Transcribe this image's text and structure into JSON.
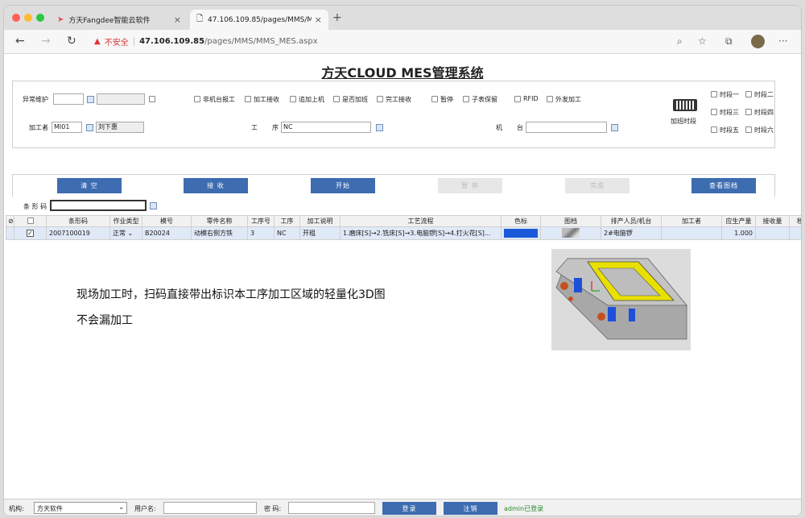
{
  "browser": {
    "tabs": [
      {
        "title": "方天Fangdee智能云软件",
        "close": "×"
      },
      {
        "title": "47.106.109.85/pages/MMS/M",
        "close": "×"
      }
    ],
    "new_tab": "+",
    "security_warning": "不安全",
    "url_host": "47.106.109.85",
    "url_path": "/pages/MMS/MMS_MES.aspx",
    "more": "···"
  },
  "page": {
    "title": "方天CLOUD MES管理系统"
  },
  "form": {
    "exception_label": "异常维护",
    "worker_label": "加工者",
    "worker_code": "MI01",
    "worker_name": "刘下惠",
    "process_label_1": "工",
    "process_label_2": "序",
    "process_value": "NC",
    "machine_label_1": "机",
    "machine_label_2": "台",
    "machine_value": "",
    "options": [
      "非机台报工",
      "加工接收",
      "追加上机",
      "是否加班",
      "完工接收",
      "暂停",
      "子表保留",
      "RFID",
      "外发加工"
    ],
    "overtime_label": "加班时段",
    "periods": [
      "时段一",
      "时段二",
      "时段三",
      "时段四",
      "时段五",
      "时段六"
    ]
  },
  "buttons": {
    "clear": "清 空",
    "receive": "接 收",
    "start": "开始",
    "pause": "暂 停",
    "done": "完成",
    "view_drawing": "查看图档"
  },
  "barcode": {
    "label": "条 形 码",
    "value": ""
  },
  "grid": {
    "headers": [
      "条形码",
      "作业类型",
      "模号",
      "零件名称",
      "工序号",
      "工序",
      "加工说明",
      "工艺流程",
      "色标",
      "图档",
      "排产人员/机台",
      "加工者",
      "应生产量",
      "接收量",
      "移转"
    ],
    "rows": [
      {
        "barcode": "2007100019",
        "job_type": "正常",
        "mold": "B20024",
        "part": "动模右侧方铁",
        "seq": "3",
        "proc": "NC",
        "desc": "开粗",
        "flow": "1.磨床[S]→2.铣床[S]→3.电脑锣[S]→4.打火花[S]...",
        "color": "#1a5ad8",
        "machine": "2#电脑锣",
        "worker": "",
        "qty": "1.000",
        "recv": "",
        "move": ""
      }
    ]
  },
  "note": {
    "line1": "现场加工时，扫码直接带出标识本工序加工区域的轻量化3D图",
    "line2": "不会漏加工"
  },
  "footer": {
    "org_label": "机构:",
    "org_value": "方天软件",
    "user_label": "用户名:",
    "user_value": "",
    "pwd_label": "密 码:",
    "pwd_value": "",
    "login": "登录",
    "logout": "注销",
    "status": "admin已登录",
    "status_color": "#2a8a2a"
  },
  "icons": {
    "tab_icon": "send-icon",
    "page_icon": "document-icon",
    "keyboard": "keyboard-icon",
    "back": "←",
    "forward": "→",
    "reload": "↻",
    "warn": "▲",
    "zoom": "🔍",
    "star": "☆"
  }
}
